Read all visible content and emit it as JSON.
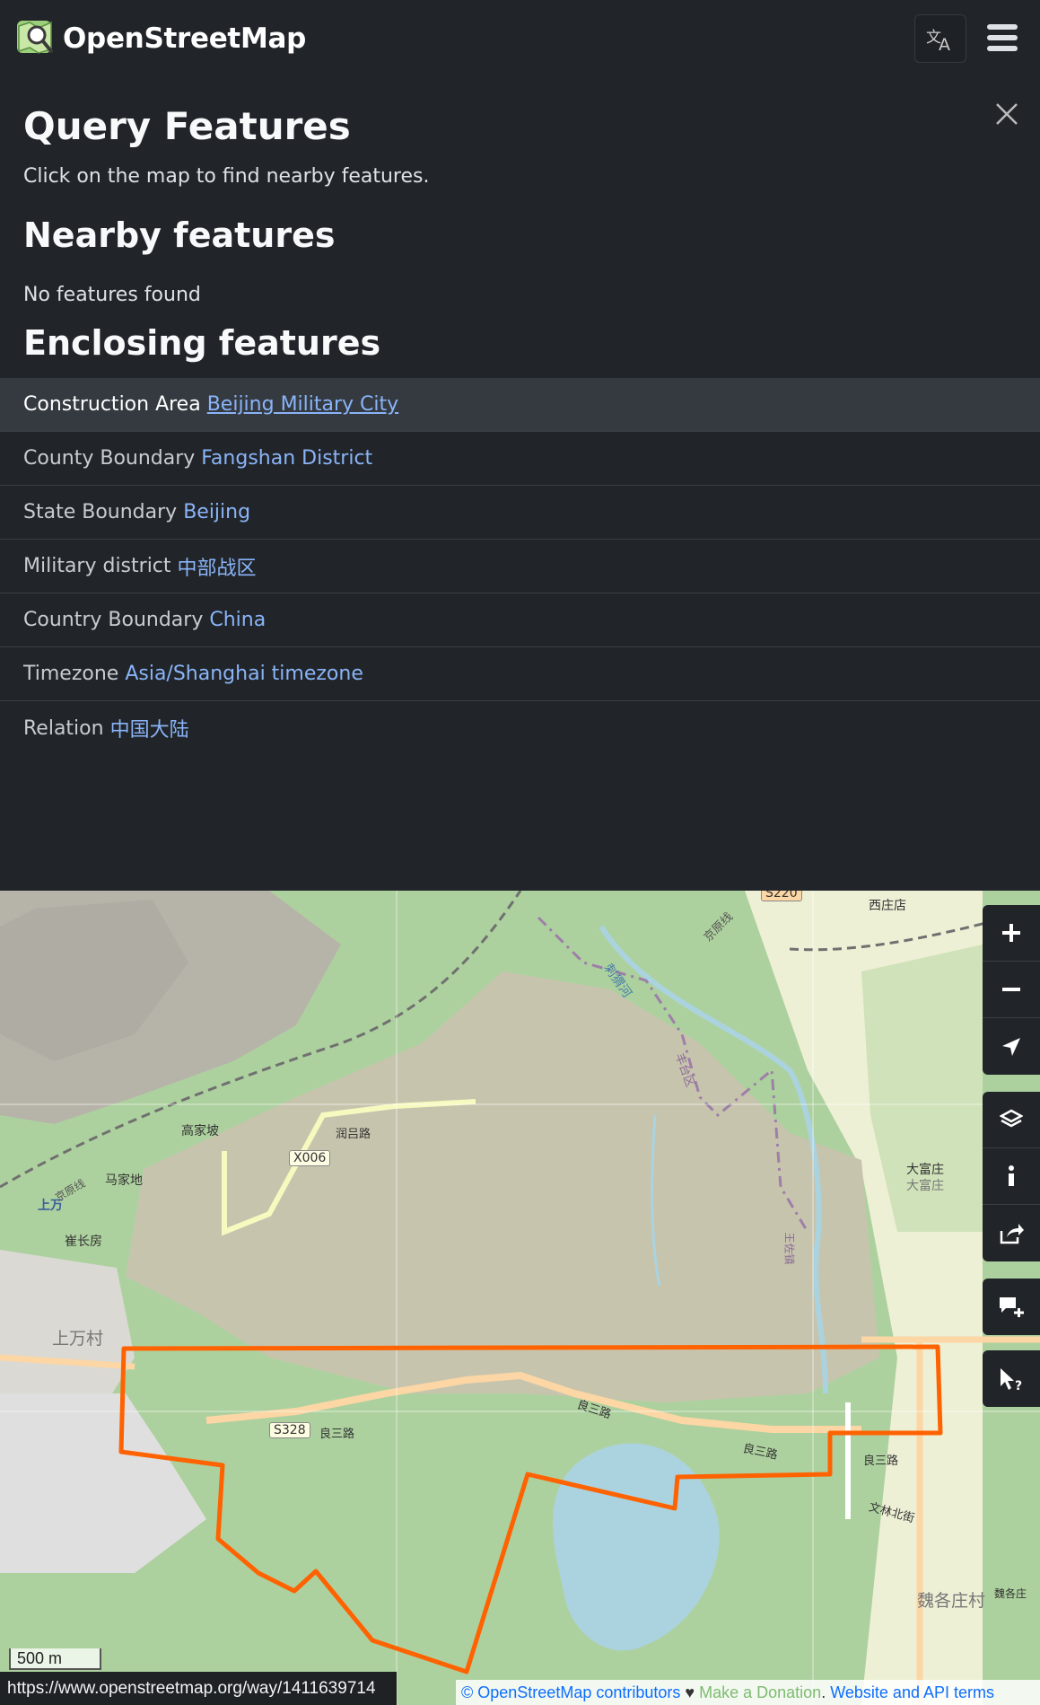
{
  "header": {
    "brand": "OpenStreetMap",
    "language_icon": "translate-icon",
    "menu_icon": "hamburger-menu-icon"
  },
  "sidebar": {
    "title": "Query Features",
    "subtitle": "Click on the map to find nearby features.",
    "nearby_heading": "Nearby features",
    "nearby_empty": "No features found",
    "enclosing_heading": "Enclosing features",
    "close_icon": "close-icon",
    "enclosing": [
      {
        "type": "Construction Area",
        "name": "Beijing Military City"
      },
      {
        "type": "County Boundary",
        "name": "Fangshan District"
      },
      {
        "type": "State Boundary",
        "name": "Beijing"
      },
      {
        "type": "Military district",
        "name": "中部战区"
      },
      {
        "type": "Country Boundary",
        "name": "China"
      },
      {
        "type": "Timezone",
        "name": "Asia/Shanghai timezone"
      },
      {
        "type": "Relation",
        "name": "中国大陆"
      }
    ]
  },
  "map": {
    "labels": {
      "gaojiapo": "高家坡",
      "x006": "X006",
      "runlu": "润吕路",
      "majiadi": "马家地",
      "shangwan": "上万",
      "cuichangfang": "崔长房",
      "shangwancun": "上万村",
      "s328": "S328",
      "liangsanlu1": "良三路",
      "liangsanlu2": "良三路",
      "liangsanlu3": "良三路",
      "liangsanlu4": "良三路",
      "xizhuangdian": "西庄店",
      "s220": "S220",
      "dafuzhuang1": "大富庄",
      "dafuzhuang2": "大富庄",
      "wenlinbeijie": "文林北街",
      "weigezhuangcun": "魏各庄村",
      "weigezhuang": "魏各庄",
      "fengtaiqu": "丰台区",
      "jinghe": "刺猬河",
      "jingyuanxian": "京原线",
      "wangzhuang": "王佐镇",
      "jiyangxian": "京原线"
    },
    "controls": {
      "zoom_in": "zoom-in-icon",
      "zoom_out": "zoom-out-icon",
      "locate": "locate-icon",
      "layers": "layers-icon",
      "info": "info-icon",
      "share": "share-icon",
      "note": "add-note-icon",
      "query": "query-features-icon"
    },
    "scale": "500 m",
    "status_url": "https://www.openstreetmap.org/way/1411639714",
    "attribution": {
      "copyright": "© OpenStreetMap contributors",
      "heart": "♥",
      "donate": "Make a Donation",
      "sep": ".",
      "terms": "Website and API terms"
    }
  },
  "colors": {
    "background": "#212529",
    "link": "#8ab4f8",
    "highlight": "#ff6200",
    "military_area": "#c7c4ae"
  }
}
